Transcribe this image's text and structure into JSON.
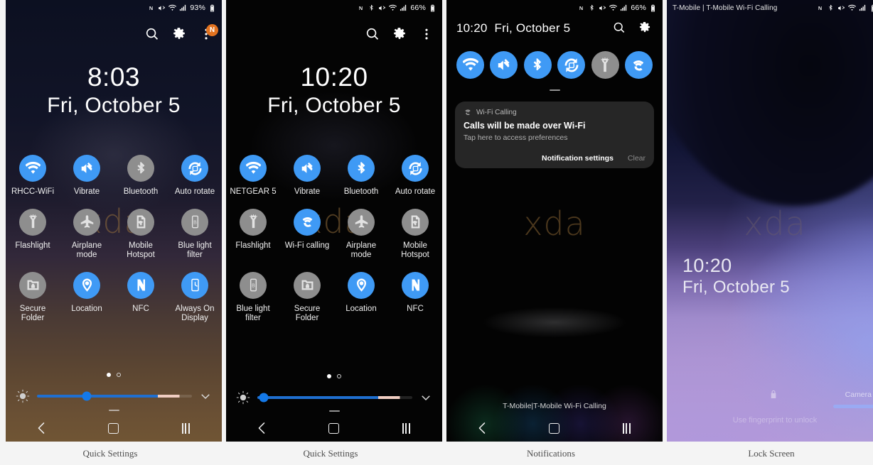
{
  "captions": [
    {
      "label": "Quick Settings"
    },
    {
      "label": "Quick Settings"
    },
    {
      "label": "Notifications"
    },
    {
      "label": "Lock Screen"
    }
  ],
  "watermark": "xda",
  "colors": {
    "tile_on": "#3f9af5",
    "tile_off": "#8e8e8e",
    "badge": "#e2721f",
    "slider_fill": "#1f6fd0",
    "slider_knob": "#1479e8"
  },
  "panel1": {
    "statusbar": {
      "battery_percent": "93%",
      "icons": [
        "nfc-icon",
        "mute-icon",
        "wifi-icon",
        "signal-icon",
        "battery-icon"
      ]
    },
    "actions": {
      "search": "search-icon",
      "settings": "gear-icon",
      "overflow": "more-vertical-icon",
      "badge_text": "N"
    },
    "clock": {
      "time": "8:03",
      "date": "Fri, October 5"
    },
    "tiles": [
      {
        "label": "RHCC-WiFi",
        "icon": "wifi-icon",
        "state": "on"
      },
      {
        "label": "Vibrate",
        "icon": "vibrate-icon",
        "state": "on"
      },
      {
        "label": "Bluetooth",
        "icon": "bluetooth-icon",
        "state": "off"
      },
      {
        "label": "Auto rotate",
        "icon": "autorotate-icon",
        "state": "on"
      },
      {
        "label": "Flashlight",
        "icon": "flashlight-icon",
        "state": "off"
      },
      {
        "label": "Airplane mode",
        "icon": "airplane-icon",
        "state": "off"
      },
      {
        "label": "Mobile Hotspot",
        "icon": "hotspot-icon",
        "state": "off"
      },
      {
        "label": "Blue light filter",
        "icon": "bluelight-icon",
        "state": "off"
      },
      {
        "label": "Secure Folder",
        "icon": "securefolder-icon",
        "state": "off"
      },
      {
        "label": "Location",
        "icon": "location-icon",
        "state": "on"
      },
      {
        "label": "NFC",
        "icon": "nfc-icon",
        "state": "on"
      },
      {
        "label": "Always On Display",
        "icon": "aod-icon",
        "state": "on"
      }
    ],
    "pages": {
      "total": 2,
      "current": 1
    },
    "brightness": {
      "value_percent": 32,
      "auto_marker_percent": 84
    },
    "navbar": [
      "back-icon",
      "home-icon",
      "recents-icon"
    ]
  },
  "panel2": {
    "statusbar": {
      "battery_percent": "66%",
      "icons": [
        "nfc-icon",
        "bluetooth-icon",
        "mute-icon",
        "wifi-icon",
        "signal-icon",
        "battery-icon"
      ]
    },
    "actions": {
      "search": "search-icon",
      "settings": "gear-icon",
      "overflow": "more-vertical-icon"
    },
    "clock": {
      "time": "10:20",
      "date": "Fri, October 5"
    },
    "tiles": [
      {
        "label": "NETGEAR 5",
        "icon": "wifi-icon",
        "state": "on"
      },
      {
        "label": "Vibrate",
        "icon": "vibrate-icon",
        "state": "on"
      },
      {
        "label": "Bluetooth",
        "icon": "bluetooth-icon",
        "state": "on"
      },
      {
        "label": "Auto rotate",
        "icon": "autorotate-icon",
        "state": "on"
      },
      {
        "label": "Flashlight",
        "icon": "flashlight-icon",
        "state": "off"
      },
      {
        "label": "Wi-Fi calling",
        "icon": "wificalling-icon",
        "state": "on"
      },
      {
        "label": "Airplane mode",
        "icon": "airplane-icon",
        "state": "off"
      },
      {
        "label": "Mobile Hotspot",
        "icon": "hotspot-icon",
        "state": "off"
      },
      {
        "label": "Blue light filter",
        "icon": "bluelight-icon",
        "state": "off"
      },
      {
        "label": "Secure Folder",
        "icon": "securefolder-icon",
        "state": "off"
      },
      {
        "label": "Location",
        "icon": "location-icon",
        "state": "on"
      },
      {
        "label": "NFC",
        "icon": "nfc-icon",
        "state": "on"
      }
    ],
    "pages": {
      "total": 2,
      "current": 1
    },
    "brightness": {
      "value_percent": 10,
      "auto_marker_percent": 84
    },
    "navbar": [
      "back-icon",
      "home-icon",
      "recents-icon"
    ]
  },
  "panel3": {
    "statusbar": {
      "battery_percent": "66%",
      "icons": [
        "nfc-icon",
        "bluetooth-icon",
        "mute-icon",
        "wifi-icon",
        "signal-icon",
        "battery-icon"
      ]
    },
    "header": {
      "time": "10:20",
      "date": "Fri, October 5",
      "search": "search-icon",
      "settings": "gear-icon"
    },
    "tiles": [
      {
        "icon": "wifi-icon",
        "state": "on"
      },
      {
        "icon": "vibrate-icon",
        "state": "on"
      },
      {
        "icon": "bluetooth-icon",
        "state": "on"
      },
      {
        "icon": "autorotate-icon",
        "state": "on"
      },
      {
        "icon": "flashlight-icon",
        "state": "off"
      },
      {
        "icon": "wificalling-icon",
        "state": "on"
      }
    ],
    "notification": {
      "app_name": "Wi-Fi Calling",
      "app_icon": "wificalling-icon",
      "title": "Calls will be made over Wi-Fi",
      "subtitle": "Tap here to access preferences",
      "settings_button": "Notification settings",
      "clear_button": "Clear"
    },
    "carrier_text": "T-Mobile|T-Mobile Wi-Fi Calling",
    "navbar": [
      "back-icon",
      "home-icon",
      "recents-icon"
    ]
  },
  "panel4": {
    "statusbar": {
      "carrier": "T-Mobile | T-Mobile Wi-Fi Calling",
      "icons": [
        "nfc-icon",
        "bluetooth-icon",
        "mute-icon",
        "wifi-icon",
        "signal-icon",
        "battery-icon"
      ]
    },
    "clock": {
      "time": "10:20",
      "date": "Fri, October 5"
    },
    "fingerprint_icon": "lock-icon",
    "hint": "Use fingerprint to unlock",
    "camera_label": "Camera"
  }
}
